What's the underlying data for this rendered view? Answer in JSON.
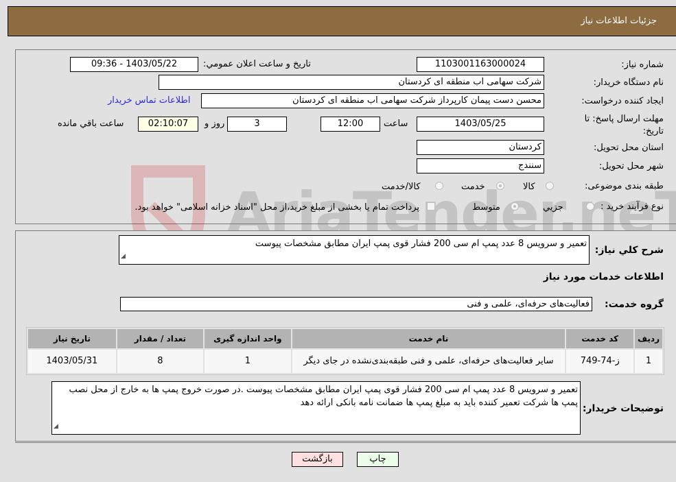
{
  "header": {
    "title": "جزئیات اطلاعات نیاز"
  },
  "form": {
    "need_number": {
      "label": "شماره نیاز:",
      "value": "1103001163000024"
    },
    "announce_datetime": {
      "label": "تاریخ و ساعت اعلان عمومي:",
      "value": "1403/05/22 - 09:36"
    },
    "buyer_org": {
      "label": "نام دستگاه خریدار:",
      "value": "شرکت سهامی اب منطقه ای کردستان"
    },
    "requester": {
      "label": "ایجاد کننده درخواست:",
      "value": "محسن دست پیمان کارپرداز شرکت سهامی اب منطقه ای کردستان"
    },
    "buyer_contact_link": "اطلاعات تماس خریدار",
    "deadline": {
      "label": "مهلت ارسال پاسخ: تا تاریخ:",
      "date": "1403/05/25",
      "time_label": "ساعت",
      "time": "12:00",
      "days": "3",
      "days_label": "روز و",
      "remaining": "02:10:07",
      "remaining_label": "ساعت باقي مانده"
    },
    "province": {
      "label": "استان محل تحویل:",
      "value": "کردستان"
    },
    "city": {
      "label": "شهر محل تحویل:",
      "value": "سنندج"
    },
    "category": {
      "label": "طبقه بندی موضوعی:",
      "options": [
        "کالا",
        "خدمت",
        "کالا/خدمت"
      ],
      "selected": "خدمت"
    },
    "process_type": {
      "label": "نوع فرآیند خرید :",
      "options": [
        "جزيي",
        "متوسط"
      ],
      "selected": "متوسط",
      "treasury_note": "پرداخت تمام یا بخشی از مبلغ خرید،از محل \"اسناد خزانه اسلامی\" خواهد بود.",
      "treasury_checked": false
    }
  },
  "description": {
    "label": "شرح كلي نیاز:",
    "value": "تعمیر و سرویس 8 عدد پمپ ام سی 200 فشار قوی پمپ ایران مطابق مشخصات پیوست"
  },
  "services_section": {
    "title": "اطلاعات خدمات مورد نیاز",
    "group_label": "گروه خدمت:",
    "group_value": "فعالیت‌های حرفه‌ای، علمی و فنی"
  },
  "table": {
    "headers": [
      "ردیف",
      "کد خدمت",
      "نام خدمت",
      "واحد اندازه گیری",
      "تعداد / مقدار",
      "تاریخ نیاز"
    ],
    "rows": [
      [
        "1",
        "ز-74-749",
        "سایر فعالیت‌های حرفه‌ای، علمی و فنی طبقه‌بندی‌نشده در جای دیگر",
        "1",
        "8",
        "1403/05/31"
      ]
    ]
  },
  "buyer_notes": {
    "label": "توضیحات خریدار:",
    "value": "تعمیر و سرویس 8 عدد پمپ ام سی 200 فشار قوی پمپ ایران مطابق مشخصات پیوست .در صورت خروج پمپ ها به خارج از محل نصب پمپ ها شرکت تعمیر کننده باید به مبلغ پمپ ها ضمانت نامه بانکی ارائه دهد"
  },
  "buttons": {
    "print": "چاپ",
    "back": "بازگشت"
  },
  "watermark": {
    "text": "AriaTender.neT"
  },
  "colors": {
    "header_bg": "#8d6c42",
    "link": "#2a2ad6",
    "back_btn": "#ffe0e0",
    "print_btn": "#ecffe8"
  }
}
